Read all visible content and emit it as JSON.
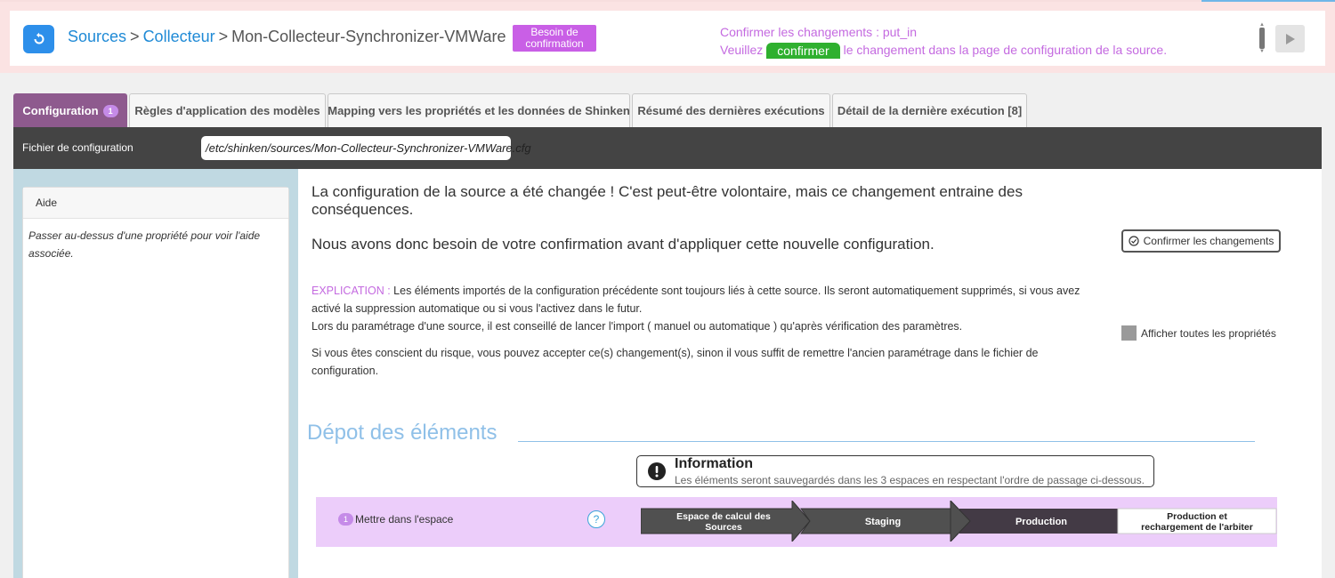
{
  "header": {
    "breadcrumb": {
      "sources": "Sources",
      "collector": "Collecteur",
      "current": "Mon-Collecteur-Synchronizer-VMWare",
      "separator": ">"
    },
    "status_badge": "Besoin de confirmation",
    "notice": {
      "line1": "Confirmer les changements : put_in",
      "line2_before": "Veuillez",
      "confirm_label": "confirmer",
      "line2_after": "le changement dans la page de configuration de la source."
    }
  },
  "tabs": [
    {
      "label": "Configuration",
      "count": "1"
    },
    {
      "label": "Règles d'application des modèles"
    },
    {
      "label": "Mapping vers les propriétés et les données de Shinken"
    },
    {
      "label": "Résumé des dernières exécutions"
    },
    {
      "label": "Détail de la dernière exécution [8]"
    }
  ],
  "config_file": {
    "label": "Fichier de configuration",
    "path": "/etc/shinken/sources/Mon-Collecteur-Synchronizer-VMWare.cfg"
  },
  "help": {
    "title": "Aide",
    "body": "Passer au-dessus d'une propriété pour voir l'aide associée."
  },
  "main": {
    "warning": "La configuration de la source a été changée ! C'est peut-être volontaire, mais ce changement entraine des conséquences.",
    "need_confirm": "Nous avons donc besoin de votre confirmation avant d'appliquer cette nouvelle configuration.",
    "confirm_changes_button": "Confirmer les changements",
    "explication_label": "EXPLICATION :",
    "explication_text": " Les éléments importés de la configuration précédente sont toujours liés à cette source. Ils seront automatiquement supprimés, si vous avez activé la suppression automatique ou si vous l'activez dans le futur.",
    "explication_line2": "Lors du paramétrage d'une source, il est conseillé de lancer l'import ( manuel ou automatique ) qu'après vérification des paramètres.",
    "risk_text": "Si vous êtes conscient du risque, vous pouvez accepter ce(s) changement(s), sinon il vous suffit de remettre l'ancien paramétrage dans le fichier de configuration.",
    "show_all_label": "Afficher toutes les propriétés"
  },
  "depot": {
    "title": "Dépot des éléments",
    "info_title": "Information",
    "info_text": "Les éléments seront sauvegardés dans les 3 espaces en respectant l'ordre de passage ci-dessous.",
    "row_number": "1",
    "row_label": "Mettre dans l'espace",
    "help_symbol": "?",
    "steps": [
      {
        "line1": "Espace de calcul des",
        "line2": "Sources"
      },
      {
        "line1": "Staging"
      },
      {
        "line1": "Production"
      },
      {
        "line1": "Production et",
        "line2": "rechargement de l'arbiter"
      }
    ]
  },
  "colors": {
    "accent_blue": "#2d8fea",
    "badge_purple": "#c95fe6",
    "active_tab": "#8e5a8e",
    "confirm_green": "#2fb02f",
    "section_blue": "#8fc0e8",
    "row_pink": "#eccdfa"
  }
}
